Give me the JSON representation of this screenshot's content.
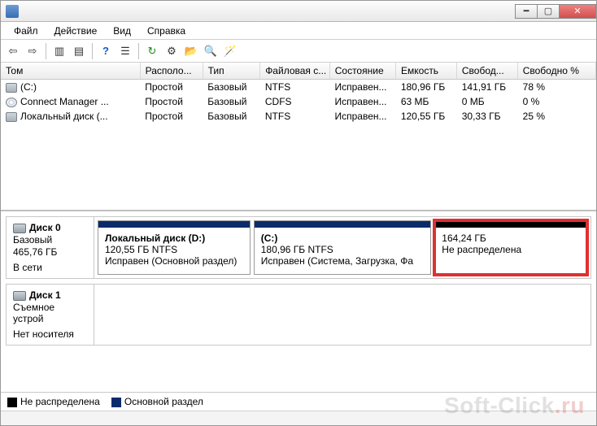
{
  "menu": {
    "file": "Файл",
    "action": "Действие",
    "view": "Вид",
    "help": "Справка"
  },
  "columns": {
    "volume": "Том",
    "layout": "Располо...",
    "type": "Тип",
    "fs": "Файловая с...",
    "status": "Состояние",
    "capacity": "Емкость",
    "free": "Свобод...",
    "freepct": "Свободно %"
  },
  "volumes": [
    {
      "name": "(C:)",
      "icon": "hd",
      "layout": "Простой",
      "type": "Базовый",
      "fs": "NTFS",
      "status": "Исправен...",
      "capacity": "180,96 ГБ",
      "free": "141,91 ГБ",
      "freepct": "78 %"
    },
    {
      "name": "Connect Manager ...",
      "icon": "cd",
      "layout": "Простой",
      "type": "Базовый",
      "fs": "CDFS",
      "status": "Исправен...",
      "capacity": "63 МБ",
      "free": "0 МБ",
      "freepct": "0 %"
    },
    {
      "name": "Локальный диск (...",
      "icon": "hd",
      "layout": "Простой",
      "type": "Базовый",
      "fs": "NTFS",
      "status": "Исправен...",
      "capacity": "120,55 ГБ",
      "free": "30,33 ГБ",
      "freepct": "25 %"
    }
  ],
  "disks": [
    {
      "name": "Диск 0",
      "type": "Базовый",
      "size": "465,76 ГБ",
      "state": "В сети",
      "parts": [
        {
          "kind": "primary",
          "title": "Локальный диск  (D:)",
          "line1": "120,55 ГБ NTFS",
          "line2": "Исправен (Основной раздел)",
          "flex": 1.1,
          "highlight": false
        },
        {
          "kind": "primary",
          "title": "(C:)",
          "line1": "180,96 ГБ NTFS",
          "line2": "Исправен (Система, Загрузка, Фа",
          "flex": 1.3,
          "highlight": false
        },
        {
          "kind": "unalloc",
          "title": "",
          "line1": "164,24 ГБ",
          "line2": "Не распределена",
          "flex": 1.1,
          "highlight": true
        }
      ]
    },
    {
      "name": "Диск 1",
      "type": "Съемное устрой",
      "size": "",
      "state": "Нет носителя",
      "parts": []
    }
  ],
  "legend": {
    "unalloc": "Не распределена",
    "primary": "Основной раздел"
  },
  "watermark": {
    "a": "Soft-Click",
    "b": ".ru"
  }
}
